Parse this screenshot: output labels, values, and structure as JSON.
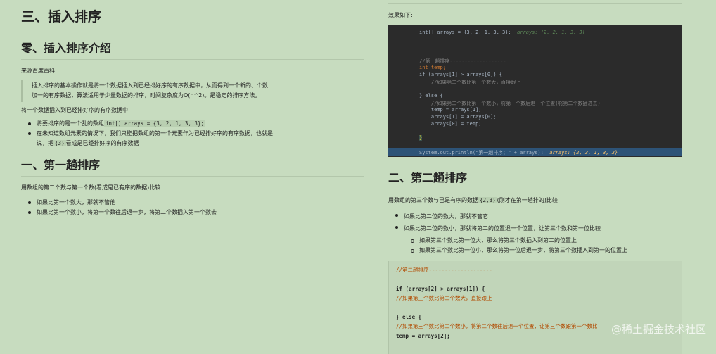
{
  "left": {
    "title": "三、插入排序",
    "intro_heading": "零、插入排序介绍",
    "source": "来源百度百科:",
    "quote1": "插入排序的基本操作就是将一个数据插入到已经排好序的有序数据中，从而得到一个新的、个数",
    "quote2": "加一的有序数据，算法适用于少量数据的排序，时间复杂度为O(n^2)。是稳定的排序方法。",
    "lead": "将一个数据插入到已经排好序的有序数据中",
    "b1_pre": "将要排序的是一个乱的数组",
    "b1_code": "int[] arrays = {3, 2, 1, 3, 3};",
    "b2_line1": "在未知道数组元素的情况下，我们只能把数组的第一个元素作为已经排好序的有序数据，也就是",
    "b2_pre": "说，把",
    "b2_code": "{3}",
    "b2_post": "看成是已经排好序的有序数据",
    "round1_heading": "一、第一趟排序",
    "round1_lead": "用数组的第二个数与第一个数(看成是已有序的数据)比较",
    "r1_b1": "如果比第一个数大，那就不管他",
    "r1_b2": "如果比第一个数小，将第一个数往后退一步，将第二个数插入第一个数去"
  },
  "right": {
    "effect": "效果如下:",
    "ide_lines": {
      "l1": "int[] arrays = {3, 2, 1, 3, 3};",
      "l1_dbg": "arrays: {2, 2, 1, 3, 3}",
      "l2": "//第一趟排序-------------------",
      "l3": "int temp;",
      "l4": "if (arrays[1] > arrays[0]) {",
      "l5": "    //如果第二个数比第一个数大，直接跟上",
      "l6": "} else {",
      "l7": "    //如果第二个数比第一个数小，将第一个数后退一个位置(将第二个数插进去)",
      "l8": "    temp = arrays[1];",
      "l9": "    arrays[1] = arrays[0];",
      "l10": "    arrays[0] = temp;",
      "l11": "}",
      "l12": "System.out.println(\"第一趟排序：\" + arrays);",
      "l12_dbg": "arrays: {2, 3, 1, 3, 3}"
    },
    "round2_heading": "二、第二趟排序",
    "round2_pre": "用数组的第三个数与已是有序的数据",
    "round2_code": "{2,3}",
    "round2_post": "(刚才在第一趟排的)比较",
    "r2_b1": "如果比第二位的数大，那就不管它",
    "r2_b2": "如果比第二位的数小，那就将第二的位置退一个位置，让第三个数和第一位比较",
    "r2_s1": "如果第三个数比第一位大，那么将第三个数插入到第二的位置上",
    "r2_s2": "如果第三个数比第一位小，那么将第一位后退一步，将第三个数插入到第一的位置上",
    "code": {
      "c1": "//第二趟排序--------------------",
      "c2": "if (arrays[2] > arrays[1]) {",
      "c3": "  //如果第三个数比第二个数大，直接跟上",
      "c4": "} else {",
      "c5": "  //如果第三个数比第二个数小，将第二个数往后退一个位置，让第三个数跟第一个数比",
      "c6": "  temp = arrays[2];"
    }
  },
  "watermark": "@稀土掘金技术社区"
}
